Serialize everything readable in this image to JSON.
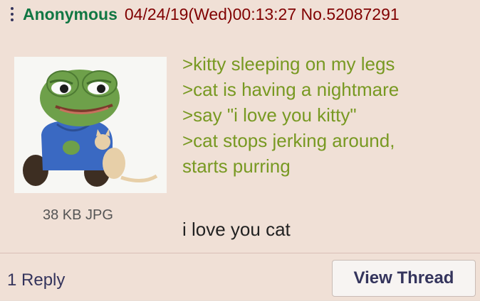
{
  "post": {
    "name": "Anonymous",
    "datetime": "04/24/19(Wed)00:13:27",
    "post_number": "No.52087291",
    "file_info": "38 KB JPG",
    "greentext": [
      ">kitty sleeping on my legs",
      ">cat is having a nightmare",
      ">say \"i love you kitty\"",
      ">cat stops jerking around,",
      "starts purring"
    ],
    "final_line": "i love you cat"
  },
  "footer": {
    "reply_count": "1 Reply",
    "view_thread_label": "View Thread"
  },
  "icons": {
    "menu": "kebab-menu-icon"
  },
  "colors": {
    "name": "#117743",
    "greentext": "#789922",
    "meta": "#800000",
    "link": "#34345c",
    "background": "#f0e0d6"
  }
}
